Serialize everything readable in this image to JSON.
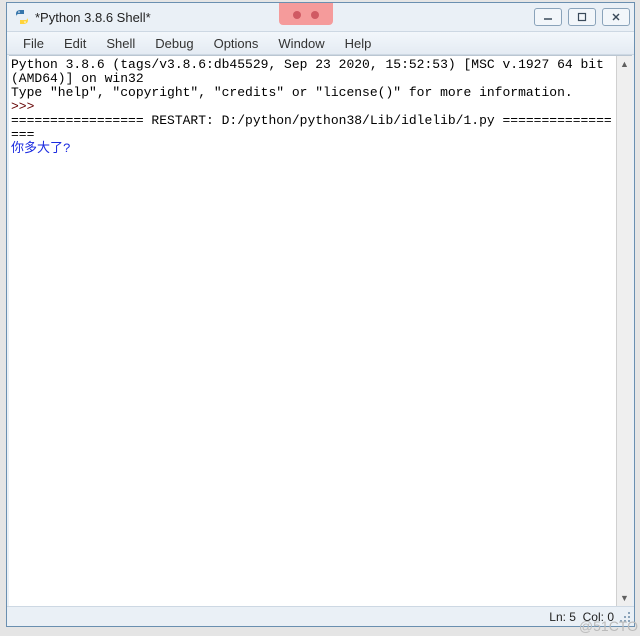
{
  "window": {
    "title": "*Python 3.8.6 Shell*"
  },
  "menu": {
    "items": [
      {
        "label": "File"
      },
      {
        "label": "Edit"
      },
      {
        "label": "Shell"
      },
      {
        "label": "Debug"
      },
      {
        "label": "Options"
      },
      {
        "label": "Window"
      },
      {
        "label": "Help"
      }
    ]
  },
  "shell": {
    "banner_line1": "Python 3.8.6 (tags/v3.8.6:db45529, Sep 23 2020, 15:52:53) [MSC v.1927 64 bit (AMD64)] on win32",
    "banner_line2": "Type \"help\", \"copyright\", \"credits\" or \"license()\" for more information.",
    "prompt": ">>> ",
    "restart_line": "================= RESTART: D:/python/python38/Lib/idlelib/1.py =================",
    "stdin_text": "你多大了? "
  },
  "status": {
    "line": "Ln: 5",
    "col": "Col: 0"
  },
  "watermark": "@51CTO"
}
